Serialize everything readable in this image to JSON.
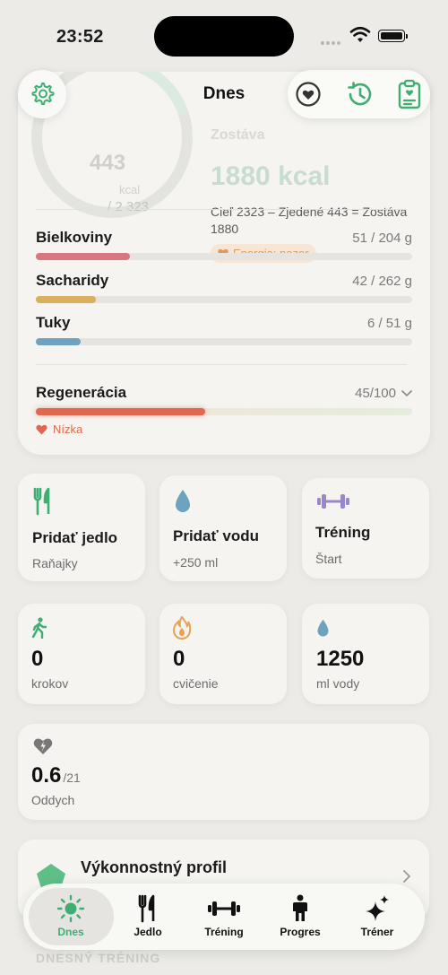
{
  "status_bar": {
    "time": "23:52"
  },
  "nav": {
    "title": "Dnes"
  },
  "calories": {
    "eaten": "443",
    "unit": "kcal",
    "goal": "/ 2 323",
    "remaining_label": "Zostáva",
    "remaining_value": "1880 kcal",
    "equation": "Cieľ 2323 – Zjedené 443 = Zostáva 1880",
    "badge": "Energia: pozor",
    "ring_progress": 0.19
  },
  "macros": [
    {
      "name": "Bielkoviny",
      "value": "51 / 204 g",
      "progress": 0.25,
      "color": "#d9777e"
    },
    {
      "name": "Sacharidy",
      "value": "42 / 262 g",
      "progress": 0.16,
      "color": "#d9b15c"
    },
    {
      "name": "Tuky",
      "value": "6 / 51 g",
      "progress": 0.12,
      "color": "#6ea3bf"
    }
  ],
  "regeneration": {
    "label": "Regenerácia",
    "value": "45/100",
    "progress": 0.45,
    "status": "Nízka",
    "color": "#e0684f"
  },
  "actions": [
    {
      "title": "Pridať jedlo",
      "subtitle": "Raňajky",
      "icon": "fork-knife-icon"
    },
    {
      "title": "Pridať vodu",
      "subtitle": "+250 ml",
      "icon": "water-drop-icon"
    },
    {
      "title": "Tréning",
      "subtitle": "Štart",
      "icon": "dumbbell-icon"
    }
  ],
  "stats": [
    {
      "value": "0",
      "label": "krokov",
      "icon": "walk-icon"
    },
    {
      "value": "0",
      "label": "cvičenie",
      "icon": "flame-icon"
    },
    {
      "value": "1250",
      "label": "ml vody",
      "icon": "water-drop-icon"
    }
  ],
  "rest": {
    "value": "0.6",
    "max": "/21",
    "label": "Oddych"
  },
  "performance": {
    "title": "Výkonnostný profil"
  },
  "section_peek": "DNESNÝ TRÉNING",
  "tabs": [
    {
      "label": "Dnes",
      "active": true
    },
    {
      "label": "Jedlo",
      "active": false
    },
    {
      "label": "Tréning",
      "active": false
    },
    {
      "label": "Progres",
      "active": false
    },
    {
      "label": "Tréner",
      "active": false
    }
  ],
  "colors": {
    "accent": "#3fae73",
    "background": "#ecebe7",
    "card": "#f5f4f0"
  }
}
